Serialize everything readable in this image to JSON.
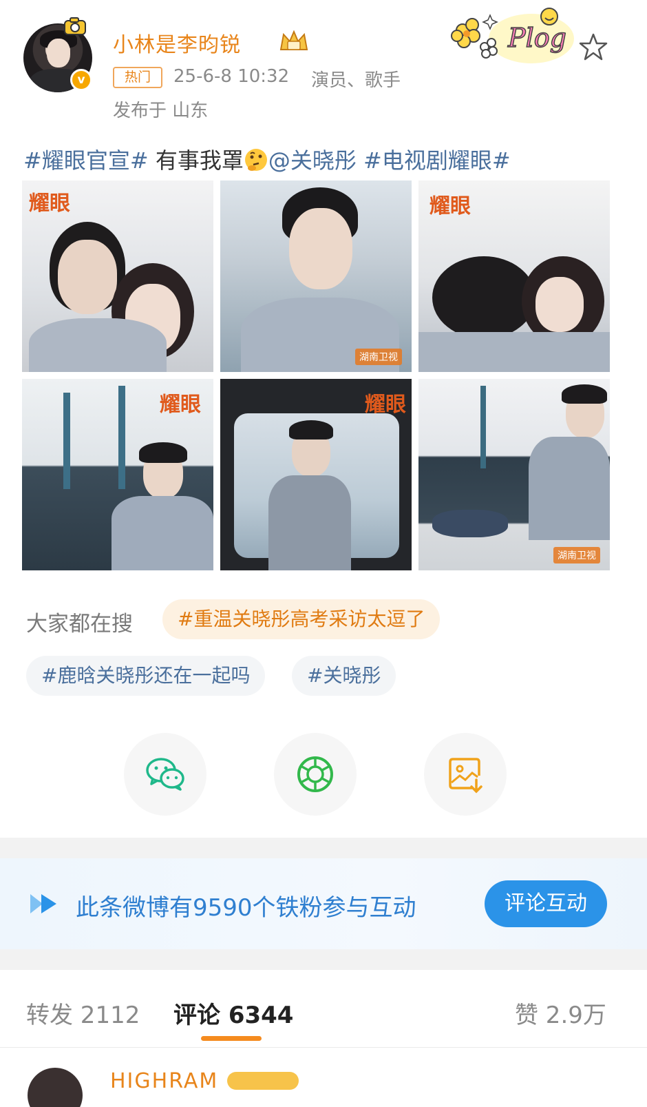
{
  "post": {
    "username": "小林是李昀锐",
    "hot_tag": "热门",
    "time": "25-6-8 10:32",
    "role": "演员、歌手",
    "location": "发布于 山东",
    "text": {
      "tag1": "#耀眼官宣#",
      "plain": " 有事我罩",
      "mention": "@关晓彤",
      "tag2": " #电视剧耀眼#"
    }
  },
  "photos": {
    "logo": "耀眼",
    "watermark": "湖南卫视"
  },
  "search": {
    "label": "大家都在搜",
    "chips": [
      "#重温关晓彤高考采访太逗了",
      "#鹿晗关晓彤还在一起吗",
      "#关晓彤"
    ]
  },
  "share": {
    "icons": [
      "wechat-icon",
      "moments-icon",
      "save-image-icon"
    ]
  },
  "fans_bar": {
    "text": "此条微博有9590个铁粉参与互动",
    "button": "评论互动"
  },
  "tabs": {
    "repost": "转发 2112",
    "comment": "评论 6344",
    "like": "赞 2.9万"
  },
  "next_comment": {
    "name": "HIGHRAM"
  },
  "colors": {
    "accent": "#e8851b",
    "link": "#4a6f9c",
    "blue_button": "#2b93e8"
  }
}
